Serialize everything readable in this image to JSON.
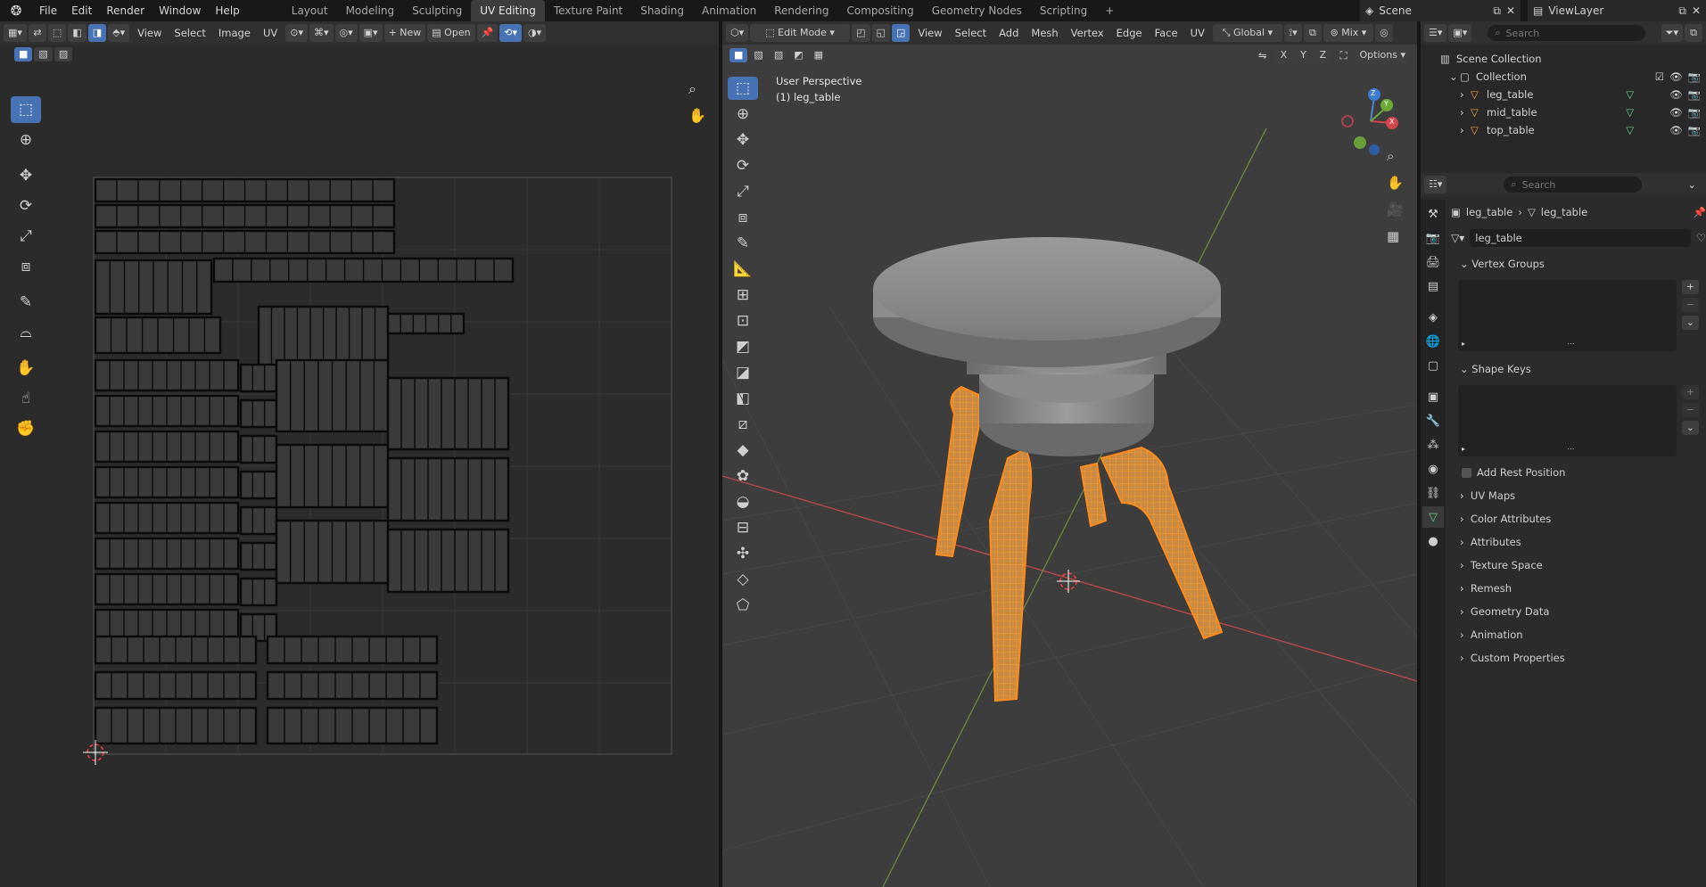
{
  "topbar": {
    "menus": [
      "File",
      "Edit",
      "Render",
      "Window",
      "Help"
    ],
    "workspaces": [
      "Layout",
      "Modeling",
      "Sculpting",
      "UV Editing",
      "Texture Paint",
      "Shading",
      "Animation",
      "Rendering",
      "Compositing",
      "Geometry Nodes",
      "Scripting"
    ],
    "active_workspace": "UV Editing",
    "add_tab": "+",
    "scene_name": "Scene",
    "view_layer": "ViewLayer"
  },
  "uv_editor": {
    "menus": [
      "View",
      "Select",
      "Image",
      "UV"
    ],
    "new_label": "New",
    "open_label": "Open",
    "tools": [
      "select-box-icon",
      "cursor-icon",
      "move-icon",
      "rotate-icon",
      "scale-icon",
      "transform-icon",
      "annotate-icon",
      "rip-icon",
      "grab-icon",
      "relax-icon",
      "pinch-icon"
    ],
    "island_color": "#000000"
  },
  "viewport": {
    "mode": "Edit Mode",
    "menus": [
      "View",
      "Select",
      "Add",
      "Mesh",
      "Vertex",
      "Edge",
      "Face",
      "UV"
    ],
    "orientation": "Global",
    "shading_mix": "Mix",
    "options_label": "Options",
    "view_name": "User Perspective",
    "object_label": "(1) leg_table",
    "axis_labels": [
      "X",
      "Y",
      "Z"
    ],
    "selection_color": "#ff8c1a",
    "gizmo": {
      "x": "X",
      "y": "Y",
      "z": "Z"
    }
  },
  "outliner": {
    "search_placeholder": "Search",
    "root": "Scene Collection",
    "collection": "Collection",
    "objects": [
      "leg_table",
      "mid_table",
      "top_table"
    ]
  },
  "properties": {
    "search_placeholder": "Search",
    "breadcrumb_object": "leg_table",
    "breadcrumb_mesh": "leg_table",
    "mesh_name": "leg_table",
    "sections_top": [
      "Vertex Groups",
      "Shape Keys"
    ],
    "add_rest_position": "Add Rest Position",
    "sections": [
      "UV Maps",
      "Color Attributes",
      "Attributes",
      "Texture Space",
      "Remesh",
      "Geometry Data",
      "Animation",
      "Custom Properties"
    ]
  }
}
